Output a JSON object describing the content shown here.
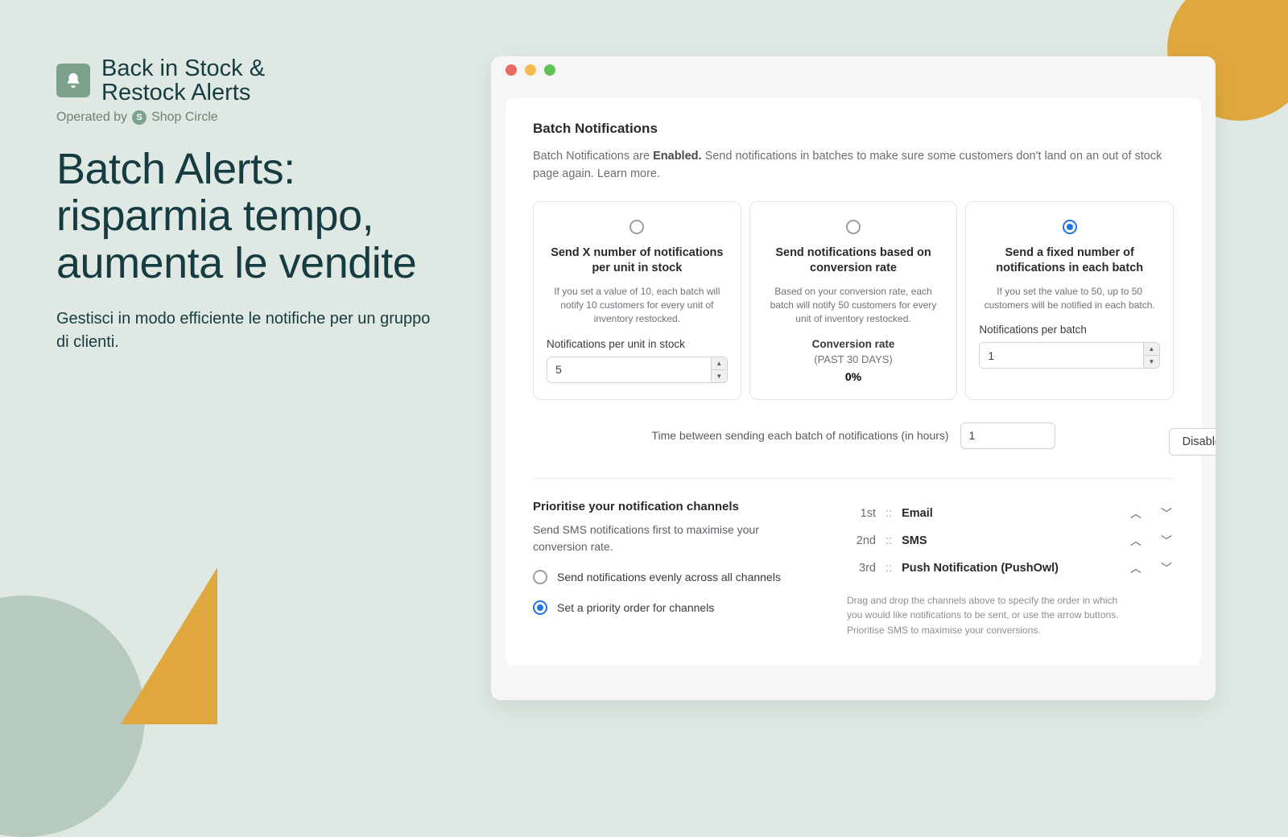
{
  "brand": {
    "logo_line1": "Back in Stock &",
    "logo_line2": "Restock Alerts",
    "operated_prefix": "Operated by",
    "operated_name": "Shop Circle"
  },
  "marketing": {
    "headline": "Batch Alerts: risparmia tempo, aumenta le vendite",
    "subhead": "Gestisci in modo efficiente le notifiche per un gruppo di clienti."
  },
  "panel": {
    "title": "Batch Notifications",
    "status_prefix": "Batch Notifications are ",
    "status_value": "Enabled.",
    "status_suffix": " Send notifications in batches to make sure some customers don't land on an out of stock page again. ",
    "learn_more": "Learn more.",
    "disable_label": "Disable",
    "cards": [
      {
        "title": "Send X number of notifications per unit in stock",
        "desc": "If you set a value of 10, each batch will notify 10 customers for every unit of inventory restocked.",
        "field_label": "Notifications per unit in stock",
        "value": "5"
      },
      {
        "title": "Send notifications based on conversion rate",
        "desc": "Based on your conversion rate, each batch will notify 50 customers for every unit of inventory restocked.",
        "conv_label": "Conversion rate",
        "past30": "(PAST 30 DAYS)",
        "conv_value": "0%"
      },
      {
        "title": "Send a fixed number of notifications in each batch",
        "desc": "If you set the value to 50, up to 50 customers will be notified in each batch.",
        "field_label": "Notifications per batch",
        "value": "1"
      }
    ],
    "time_label": "Time between sending each batch of notifications (in hours)",
    "time_value": "1"
  },
  "priority": {
    "title": "Prioritise your notification channels",
    "subtitle": "Send SMS notifications first to maximise your conversion rate.",
    "options": {
      "even": "Send notifications evenly across all channels",
      "order": "Set a priority order for channels"
    },
    "channels": [
      {
        "ord": "1st",
        "name": "Email"
      },
      {
        "ord": "2nd",
        "name": "SMS"
      },
      {
        "ord": "3rd",
        "name": "Push Notification (PushOwl)"
      }
    ],
    "help": "Drag and drop the channels above to specify the order in which you would like notifications to be sent, or use the arrow buttons. Prioritise SMS to maximise your conversions."
  }
}
